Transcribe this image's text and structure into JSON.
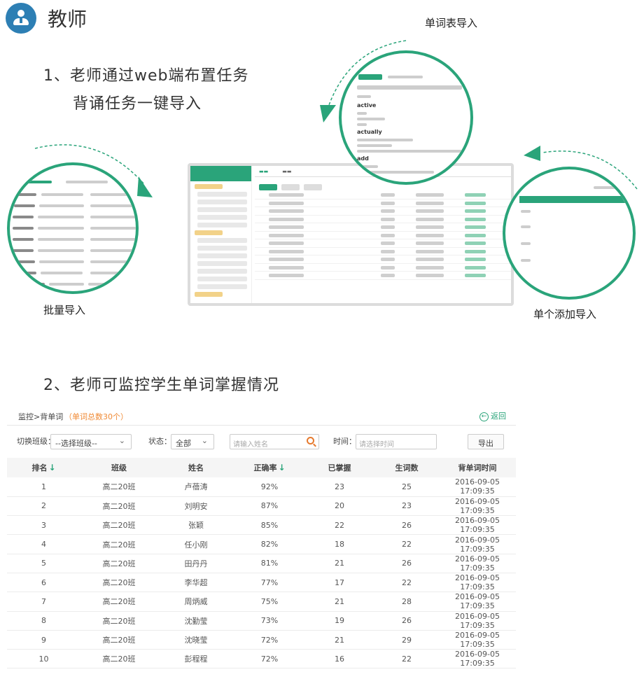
{
  "header": {
    "title": "教师"
  },
  "section1": {
    "line1": "1、老师通过web端布置任务",
    "line2": "背诵任务一键导入"
  },
  "captions": {
    "wordlist_import": "单词表导入",
    "batch_import": "批量导入",
    "single_import": "单个添加导入"
  },
  "section2": {
    "title": "2、老师可监控学生单词掌握情况"
  },
  "zoom_words": [
    "active",
    "actually",
    "add"
  ],
  "colors": {
    "accent": "#2aa47a",
    "icon_bg": "#2d7fb4",
    "highlight": "#f08a35"
  },
  "monitor": {
    "breadcrumb": "监控>背单词",
    "word_count": "（单词总数30个）",
    "back_label": "返回",
    "filters": {
      "class_label": "切换班级：",
      "class_value": "--选择班级--",
      "status_label": "状态：",
      "status_value": "全部",
      "name_placeholder": "请输入姓名",
      "time_label": "时间：",
      "time_placeholder": "请选择时间",
      "export_label": "导出"
    },
    "columns": [
      "排名",
      "班级",
      "姓名",
      "正确率",
      "已掌握",
      "生词数",
      "背单词时间"
    ],
    "rows": [
      [
        "1",
        "高二20班",
        "卢蓓涛",
        "92%",
        "23",
        "25",
        "2016-09-05 17:09:35"
      ],
      [
        "2",
        "高二20班",
        "刘明安",
        "87%",
        "20",
        "23",
        "2016-09-05 17:09:35"
      ],
      [
        "3",
        "高二20班",
        "张颖",
        "85%",
        "22",
        "26",
        "2016-09-05 17:09:35"
      ],
      [
        "4",
        "高二20班",
        "任小刚",
        "82%",
        "18",
        "22",
        "2016-09-05 17:09:35"
      ],
      [
        "5",
        "高二20班",
        "田丹丹",
        "81%",
        "21",
        "26",
        "2016-09-05 17:09:35"
      ],
      [
        "6",
        "高二20班",
        "李华超",
        "77%",
        "17",
        "22",
        "2016-09-05 17:09:35"
      ],
      [
        "7",
        "高二20班",
        "周炳威",
        "75%",
        "21",
        "28",
        "2016-09-05 17:09:35"
      ],
      [
        "8",
        "高二20班",
        "沈勤莹",
        "73%",
        "19",
        "26",
        "2016-09-05 17:09:35"
      ],
      [
        "9",
        "高二20班",
        "沈晓莹",
        "72%",
        "21",
        "29",
        "2016-09-05 17:09:35"
      ],
      [
        "10",
        "高二20班",
        "彭程程",
        "72%",
        "16",
        "22",
        "2016-09-05 17:09:35"
      ]
    ]
  }
}
